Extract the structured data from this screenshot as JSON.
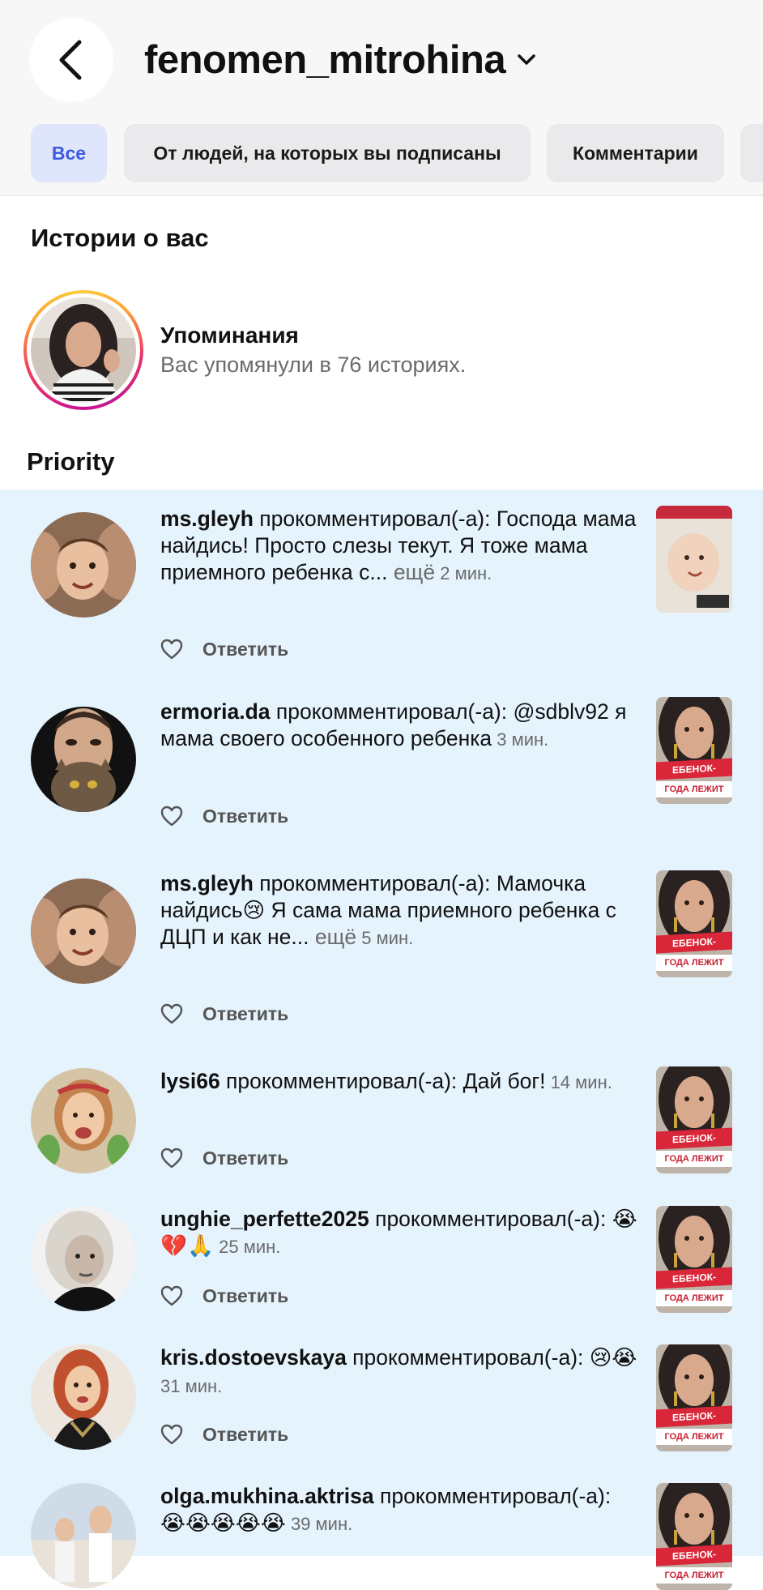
{
  "header": {
    "title": "fenomen_mitrohina"
  },
  "filters": [
    {
      "label": "Все",
      "active": true
    },
    {
      "label": "От людей, на которых вы подписаны",
      "active": false
    },
    {
      "label": "Комментарии",
      "active": false
    }
  ],
  "stories_section": {
    "title": "Истории о вас",
    "mentions_title": "Упоминания",
    "mentions_subtitle": "Вас упомянули в 76 историях."
  },
  "priority_section": {
    "title": "Priority"
  },
  "reply_label": "Ответить",
  "thumb_text": {
    "line1": "ЕБЕНОК-",
    "line2": "ГОДА ЛЕЖИТ"
  },
  "notifications": [
    {
      "user": "ms.gleyh",
      "text": " прокомментировал(-а): Господа мама найдись! Просто слезы текут. Я тоже мама приемного ребенка с...",
      "more": " ещё",
      "time": " 2 мин."
    },
    {
      "user": "ermoria.da",
      "text": " прокомментировал(-а): @sdblv92 я мама своего особенного ребенка",
      "more": "",
      "time": " 3 мин."
    },
    {
      "user": "ms.gleyh",
      "text": " прокомментировал(-а): Мамочка найдись😢 Я сама мама приемного ребенка с ДЦП и как не...",
      "more": " ещё",
      "time": " 5 мин."
    },
    {
      "user": "lysi66",
      "text": " прокомментировал(-а): Дай бог!",
      "more": "",
      "time": " 14 мин."
    },
    {
      "user": "unghie_perfette2025",
      "text": " прокомментировал(-а): 😭💔🙏",
      "more": "",
      "time": " 25 мин."
    },
    {
      "user": "kris.dostoevskaya",
      "text": " прокомментировал(-а): 😢😭",
      "more": "",
      "time": " 31 мин."
    },
    {
      "user": "olga.mukhina.aktrisa",
      "text": " прокомментировал(-а): 😭😭😭😭😭",
      "more": "",
      "time": " 39 мин."
    }
  ]
}
